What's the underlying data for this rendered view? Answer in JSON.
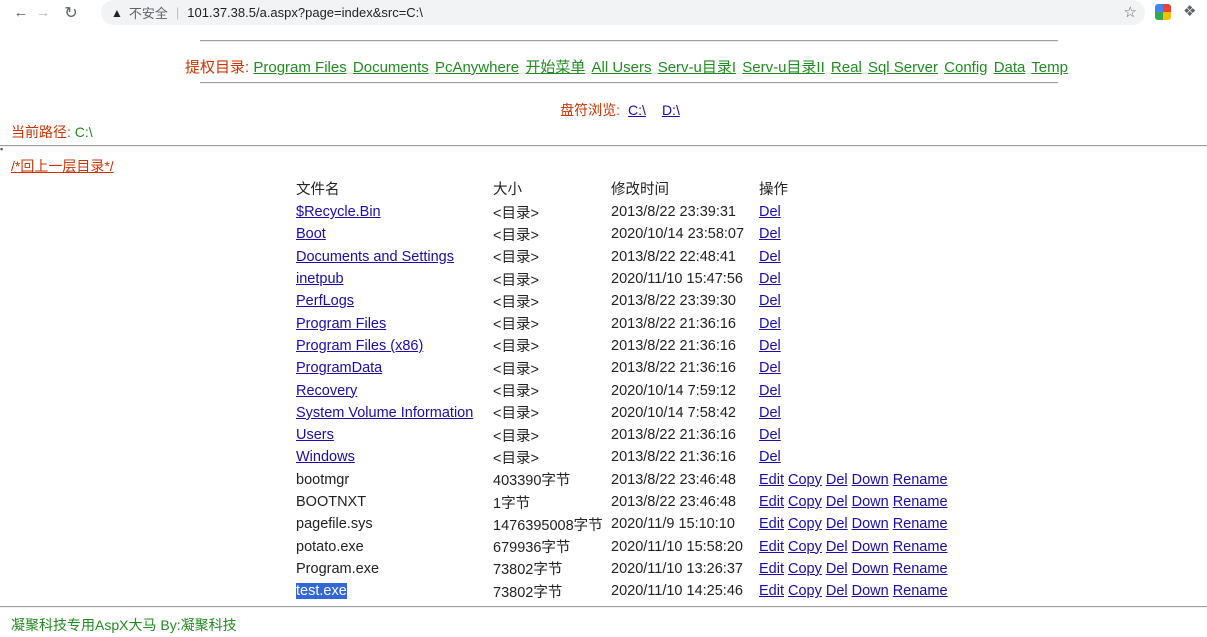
{
  "browser": {
    "insecure_label": "不安全",
    "separator": "|",
    "url": "101.37.38.5/a.aspx?page=index&src=C:\\"
  },
  "privilege": {
    "label": "提权目录:",
    "links": [
      "Program Files",
      "Documents",
      "PcAnywhere",
      "开始菜单",
      "All Users",
      "Serv-u目录I",
      "Serv-u目录II",
      "Real",
      "Sql Server",
      "Config",
      "Data",
      "Temp"
    ]
  },
  "drives": {
    "label": "盘符浏览:",
    "links": [
      "C:\\",
      "D:\\"
    ]
  },
  "current_path": {
    "label": "当前路径:",
    "value": "C:\\"
  },
  "up_link": "/*回上一层目录*/",
  "table": {
    "headers": [
      "文件名",
      "大小",
      "修改时间",
      "操作"
    ],
    "rows": [
      {
        "name": "$Recycle.Bin",
        "size": "<目录>",
        "time": "2013/8/22 23:39:31",
        "dir": true
      },
      {
        "name": "Boot",
        "size": "<目录>",
        "time": "2020/10/14 23:58:07",
        "dir": true
      },
      {
        "name": "Documents and Settings",
        "size": "<目录>",
        "time": "2013/8/22 22:48:41",
        "dir": true
      },
      {
        "name": "inetpub",
        "size": "<目录>",
        "time": "2020/11/10 15:47:56",
        "dir": true
      },
      {
        "name": "PerfLogs",
        "size": "<目录>",
        "time": "2013/8/22 23:39:30",
        "dir": true
      },
      {
        "name": "Program Files",
        "size": "<目录>",
        "time": "2013/8/22 21:36:16",
        "dir": true
      },
      {
        "name": "Program Files (x86)",
        "size": "<目录>",
        "time": "2013/8/22 21:36:16",
        "dir": true
      },
      {
        "name": "ProgramData",
        "size": "<目录>",
        "time": "2013/8/22 21:36:16",
        "dir": true
      },
      {
        "name": "Recovery",
        "size": "<目录>",
        "time": "2020/10/14 7:59:12",
        "dir": true
      },
      {
        "name": "System Volume Information",
        "size": "<目录>",
        "time": "2020/10/14 7:58:42",
        "dir": true
      },
      {
        "name": "Users",
        "size": "<目录>",
        "time": "2013/8/22 21:36:16",
        "dir": true
      },
      {
        "name": "Windows",
        "size": "<目录>",
        "time": "2013/8/22 21:36:16",
        "dir": true
      },
      {
        "name": "bootmgr",
        "size": "403390字节",
        "time": "2013/8/22 23:46:48",
        "dir": false
      },
      {
        "name": "BOOTNXT",
        "size": "1字节",
        "time": "2013/8/22 23:46:48",
        "dir": false
      },
      {
        "name": "pagefile.sys",
        "size": "1476395008字节",
        "time": "2020/11/9 15:10:10",
        "dir": false
      },
      {
        "name": "potato.exe",
        "size": "679936字节",
        "time": "2020/11/10 15:58:20",
        "dir": false
      },
      {
        "name": "Program.exe",
        "size": "73802字节",
        "time": "2020/11/10 13:26:37",
        "dir": false
      },
      {
        "name": "test.exe",
        "size": "73802字节",
        "time": "2020/11/10 14:25:46",
        "dir": false,
        "selected": true
      }
    ],
    "dir_ops": [
      "Del"
    ],
    "file_ops": [
      "Edit",
      "Copy",
      "Del",
      "Down",
      "Rename"
    ]
  },
  "footer": "凝聚科技专用AspX大马 By:凝聚科技",
  "colors": {
    "label_red": "#cc3300",
    "link_green": "#228b22",
    "link_blue": "#1a0dab",
    "selection": "#3367d6"
  },
  "icons": [
    "back-icon",
    "forward-icon",
    "reload-icon",
    "warning-icon",
    "star-icon",
    "extension-icon",
    "puzzle-icon"
  ]
}
